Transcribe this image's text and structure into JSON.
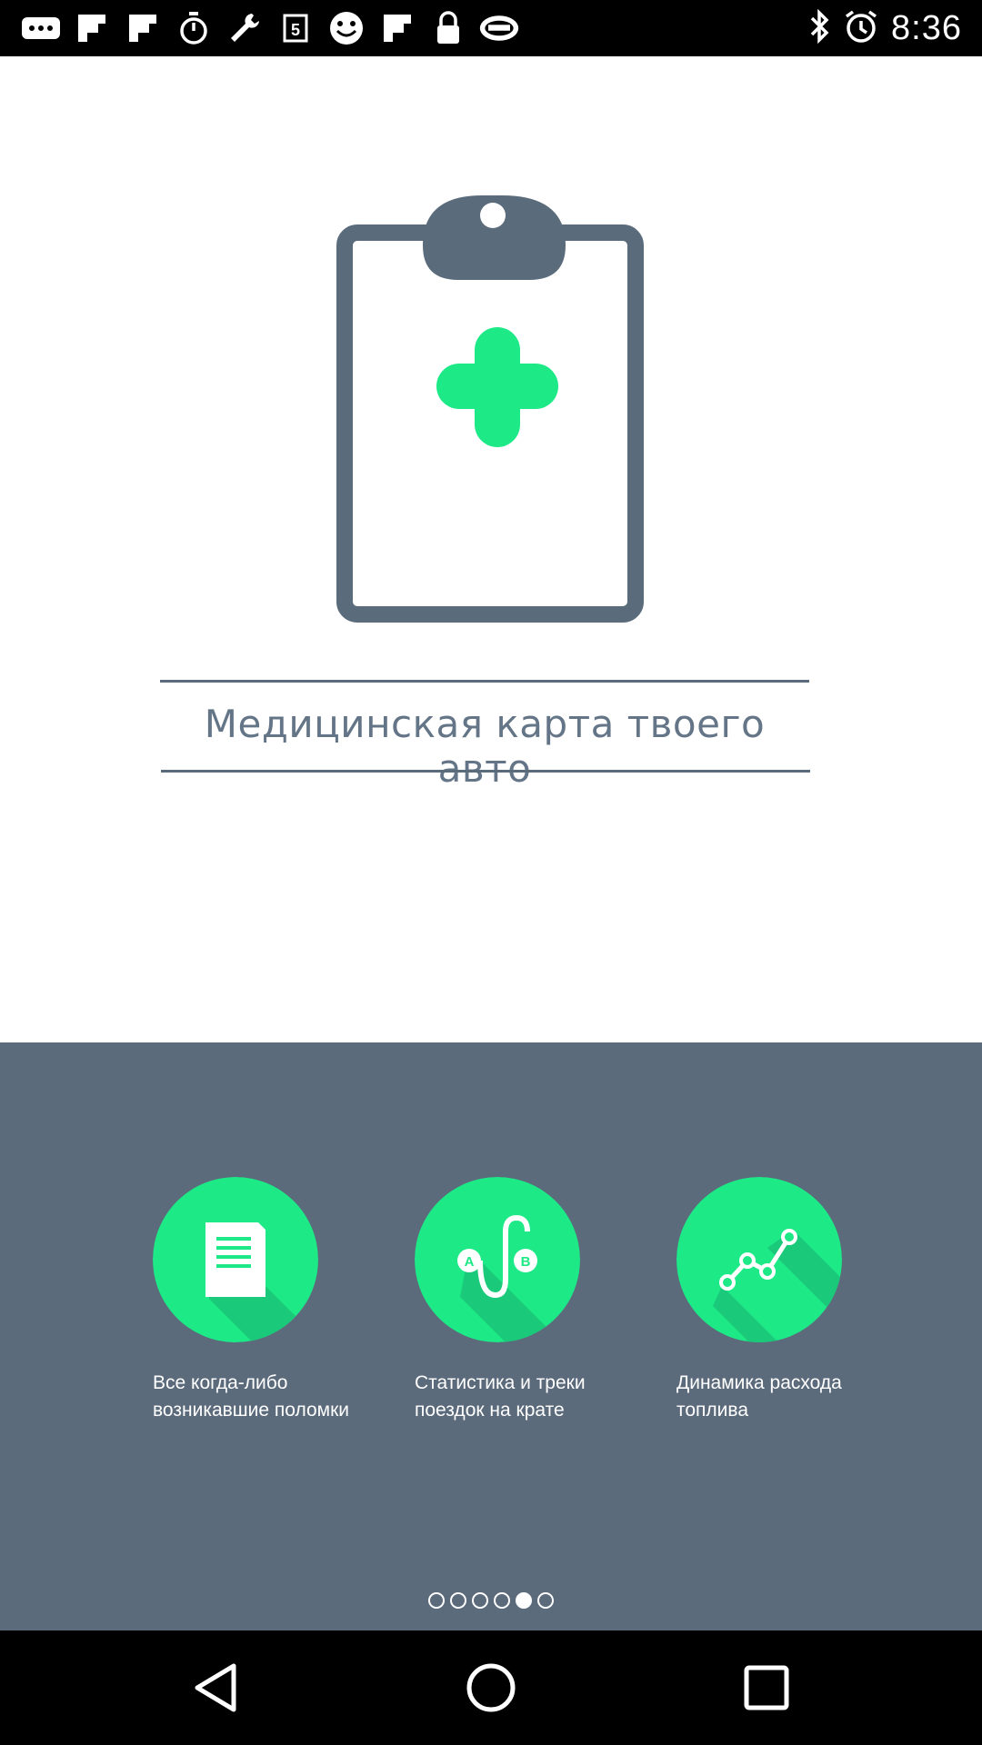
{
  "status_bar": {
    "time": "8:36",
    "left_icons": [
      "more-icon",
      "flipboard-icon",
      "flipboard-icon",
      "stopwatch-icon",
      "wrench-icon",
      "replay-5-icon",
      "smiley-icon",
      "flipboard-icon",
      "lock-icon",
      "fox-sports-icon"
    ],
    "right_icons": [
      "bluetooth-icon",
      "alarm-icon"
    ]
  },
  "intro": {
    "illustration": "clipboard-medical-icon",
    "headline": "Медицинская карта твоего авто"
  },
  "features": [
    {
      "icon": "document-icon",
      "label": "Все когда-либо возникавшие поломки"
    },
    {
      "icon": "route-ab-icon",
      "label": "Статистика и треки поездок на крате"
    },
    {
      "icon": "line-chart-icon",
      "label": "Динамика расхода топлива"
    }
  ],
  "pager": {
    "total": 6,
    "active_index": 4
  },
  "colors": {
    "panel": "#5c6b7c",
    "accent_green": "#1de987",
    "clipboard_gray": "#5a6b7b",
    "headline_text": "#647587"
  }
}
